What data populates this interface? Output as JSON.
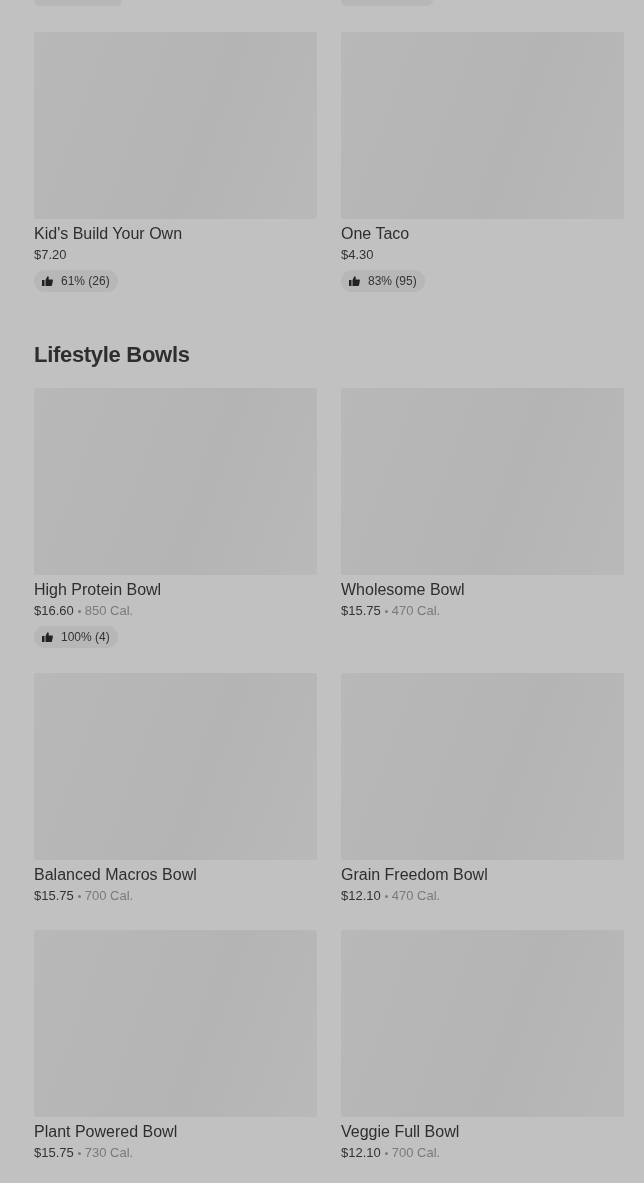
{
  "sections": [
    {
      "items": [
        {
          "name": "Kid's Build Your Own",
          "price": "$7.20",
          "rating": "61% (26)"
        },
        {
          "name": "One Taco",
          "price": "$4.30",
          "rating": "83% (95)"
        }
      ]
    },
    {
      "heading": "Lifestyle Bowls",
      "items": [
        {
          "name": "High Protein Bowl",
          "price": "$16.60",
          "calories": "850 Cal.",
          "rating": "100% (4)"
        },
        {
          "name": "Wholesome Bowl",
          "price": "$15.75",
          "calories": "470 Cal."
        },
        {
          "name": "Balanced Macros Bowl",
          "price": "$15.75",
          "calories": "700 Cal."
        },
        {
          "name": "Grain Freedom Bowl",
          "price": "$12.10",
          "calories": "470 Cal."
        },
        {
          "name": "Plant Powered Bowl",
          "price": "$15.75",
          "calories": "730 Cal."
        },
        {
          "name": "Veggie Full Bowl",
          "price": "$12.10",
          "calories": "700 Cal."
        }
      ]
    }
  ]
}
